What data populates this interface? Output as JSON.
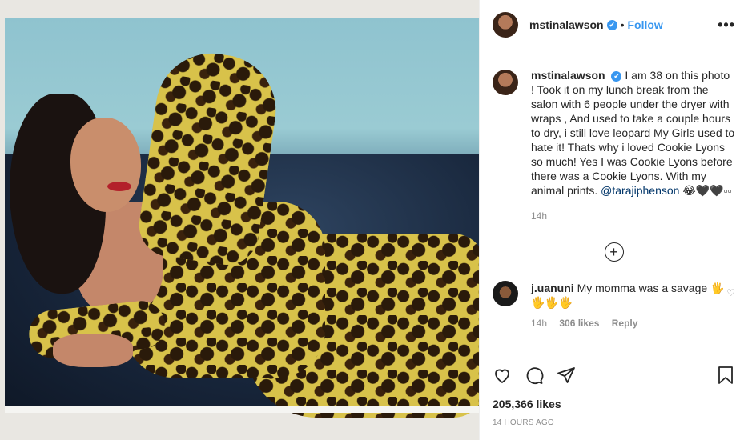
{
  "post": {
    "username": "mstinalawson",
    "verified_mark": "✔",
    "separator": "•",
    "follow_label": "Follow",
    "more_label": "•••"
  },
  "caption": {
    "username": "mstinalawson",
    "text_before_mention": "I am 38 on this photo ! Took it on my lunch break from the salon with 6 people under the dryer with wraps , And used to take a couple hours to dry, i still love leopard My Girls used to hate it! Thats why i loved Cookie Lyons so much! Yes I was Cookie Lyons before there was a Cookie Lyons. With my animal prints.",
    "mention": "@tarajiphenson",
    "text_after_mention": "😂🖤🖤▫▫",
    "time": "14h"
  },
  "load_more_icon": "+",
  "comment": {
    "username": "j.uanuni",
    "text": "My momma was a savage 🖐🖐🖐🖐",
    "time": "14h",
    "likes": "306 likes",
    "reply": "Reply",
    "like_icon": "♡"
  },
  "actions": {
    "like_icon": "heart-icon",
    "comment_icon": "comment-icon",
    "share_icon": "share-icon",
    "save_icon": "bookmark-icon"
  },
  "likes_count": "205,366 likes",
  "posted_time": "14 HOURS AGO",
  "colors": {
    "link": "#3897f0",
    "muted": "#8e8e8e",
    "text": "#262626",
    "border": "#efefef"
  }
}
